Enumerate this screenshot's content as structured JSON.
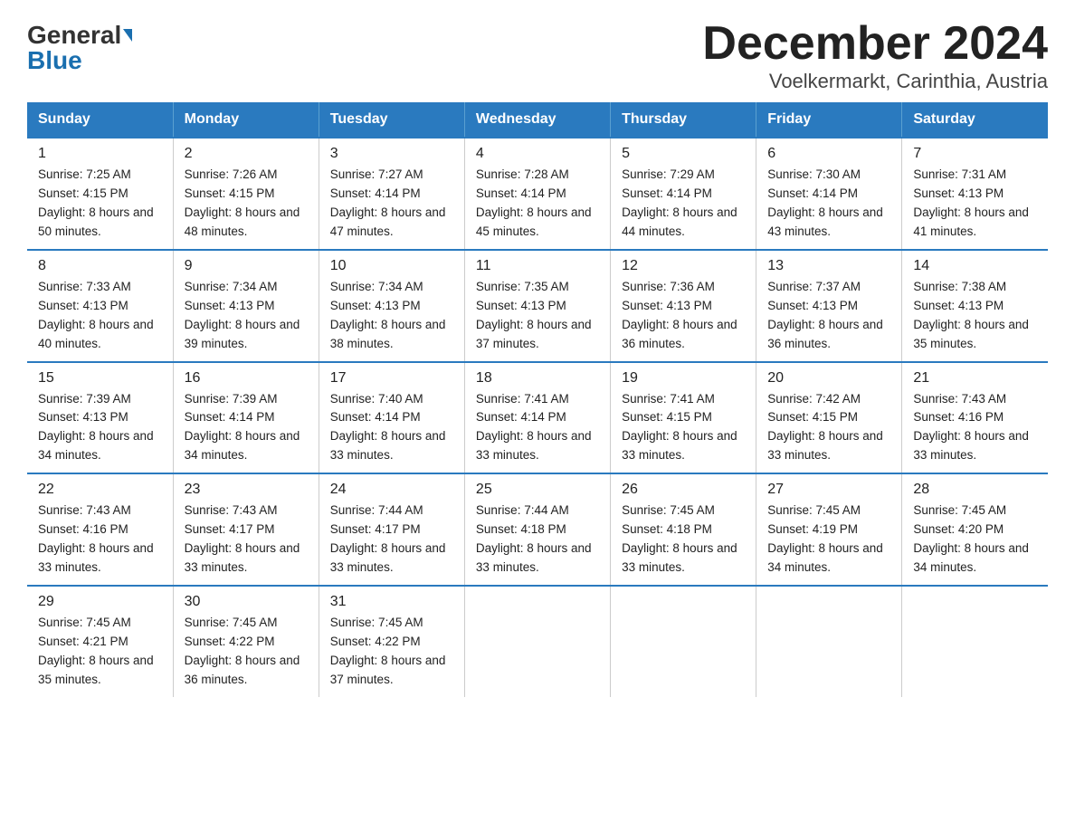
{
  "logo": {
    "general": "General",
    "blue": "Blue"
  },
  "title": "December 2024",
  "subtitle": "Voelkermarkt, Carinthia, Austria",
  "weekdays": [
    "Sunday",
    "Monday",
    "Tuesday",
    "Wednesday",
    "Thursday",
    "Friday",
    "Saturday"
  ],
  "weeks": [
    [
      {
        "day": "1",
        "sunrise": "7:25 AM",
        "sunset": "4:15 PM",
        "daylight": "8 hours and 50 minutes."
      },
      {
        "day": "2",
        "sunrise": "7:26 AM",
        "sunset": "4:15 PM",
        "daylight": "8 hours and 48 minutes."
      },
      {
        "day": "3",
        "sunrise": "7:27 AM",
        "sunset": "4:14 PM",
        "daylight": "8 hours and 47 minutes."
      },
      {
        "day": "4",
        "sunrise": "7:28 AM",
        "sunset": "4:14 PM",
        "daylight": "8 hours and 45 minutes."
      },
      {
        "day": "5",
        "sunrise": "7:29 AM",
        "sunset": "4:14 PM",
        "daylight": "8 hours and 44 minutes."
      },
      {
        "day": "6",
        "sunrise": "7:30 AM",
        "sunset": "4:14 PM",
        "daylight": "8 hours and 43 minutes."
      },
      {
        "day": "7",
        "sunrise": "7:31 AM",
        "sunset": "4:13 PM",
        "daylight": "8 hours and 41 minutes."
      }
    ],
    [
      {
        "day": "8",
        "sunrise": "7:33 AM",
        "sunset": "4:13 PM",
        "daylight": "8 hours and 40 minutes."
      },
      {
        "day": "9",
        "sunrise": "7:34 AM",
        "sunset": "4:13 PM",
        "daylight": "8 hours and 39 minutes."
      },
      {
        "day": "10",
        "sunrise": "7:34 AM",
        "sunset": "4:13 PM",
        "daylight": "8 hours and 38 minutes."
      },
      {
        "day": "11",
        "sunrise": "7:35 AM",
        "sunset": "4:13 PM",
        "daylight": "8 hours and 37 minutes."
      },
      {
        "day": "12",
        "sunrise": "7:36 AM",
        "sunset": "4:13 PM",
        "daylight": "8 hours and 36 minutes."
      },
      {
        "day": "13",
        "sunrise": "7:37 AM",
        "sunset": "4:13 PM",
        "daylight": "8 hours and 36 minutes."
      },
      {
        "day": "14",
        "sunrise": "7:38 AM",
        "sunset": "4:13 PM",
        "daylight": "8 hours and 35 minutes."
      }
    ],
    [
      {
        "day": "15",
        "sunrise": "7:39 AM",
        "sunset": "4:13 PM",
        "daylight": "8 hours and 34 minutes."
      },
      {
        "day": "16",
        "sunrise": "7:39 AM",
        "sunset": "4:14 PM",
        "daylight": "8 hours and 34 minutes."
      },
      {
        "day": "17",
        "sunrise": "7:40 AM",
        "sunset": "4:14 PM",
        "daylight": "8 hours and 33 minutes."
      },
      {
        "day": "18",
        "sunrise": "7:41 AM",
        "sunset": "4:14 PM",
        "daylight": "8 hours and 33 minutes."
      },
      {
        "day": "19",
        "sunrise": "7:41 AM",
        "sunset": "4:15 PM",
        "daylight": "8 hours and 33 minutes."
      },
      {
        "day": "20",
        "sunrise": "7:42 AM",
        "sunset": "4:15 PM",
        "daylight": "8 hours and 33 minutes."
      },
      {
        "day": "21",
        "sunrise": "7:43 AM",
        "sunset": "4:16 PM",
        "daylight": "8 hours and 33 minutes."
      }
    ],
    [
      {
        "day": "22",
        "sunrise": "7:43 AM",
        "sunset": "4:16 PM",
        "daylight": "8 hours and 33 minutes."
      },
      {
        "day": "23",
        "sunrise": "7:43 AM",
        "sunset": "4:17 PM",
        "daylight": "8 hours and 33 minutes."
      },
      {
        "day": "24",
        "sunrise": "7:44 AM",
        "sunset": "4:17 PM",
        "daylight": "8 hours and 33 minutes."
      },
      {
        "day": "25",
        "sunrise": "7:44 AM",
        "sunset": "4:18 PM",
        "daylight": "8 hours and 33 minutes."
      },
      {
        "day": "26",
        "sunrise": "7:45 AM",
        "sunset": "4:18 PM",
        "daylight": "8 hours and 33 minutes."
      },
      {
        "day": "27",
        "sunrise": "7:45 AM",
        "sunset": "4:19 PM",
        "daylight": "8 hours and 34 minutes."
      },
      {
        "day": "28",
        "sunrise": "7:45 AM",
        "sunset": "4:20 PM",
        "daylight": "8 hours and 34 minutes."
      }
    ],
    [
      {
        "day": "29",
        "sunrise": "7:45 AM",
        "sunset": "4:21 PM",
        "daylight": "8 hours and 35 minutes."
      },
      {
        "day": "30",
        "sunrise": "7:45 AM",
        "sunset": "4:22 PM",
        "daylight": "8 hours and 36 minutes."
      },
      {
        "day": "31",
        "sunrise": "7:45 AM",
        "sunset": "4:22 PM",
        "daylight": "8 hours and 37 minutes."
      },
      null,
      null,
      null,
      null
    ]
  ]
}
